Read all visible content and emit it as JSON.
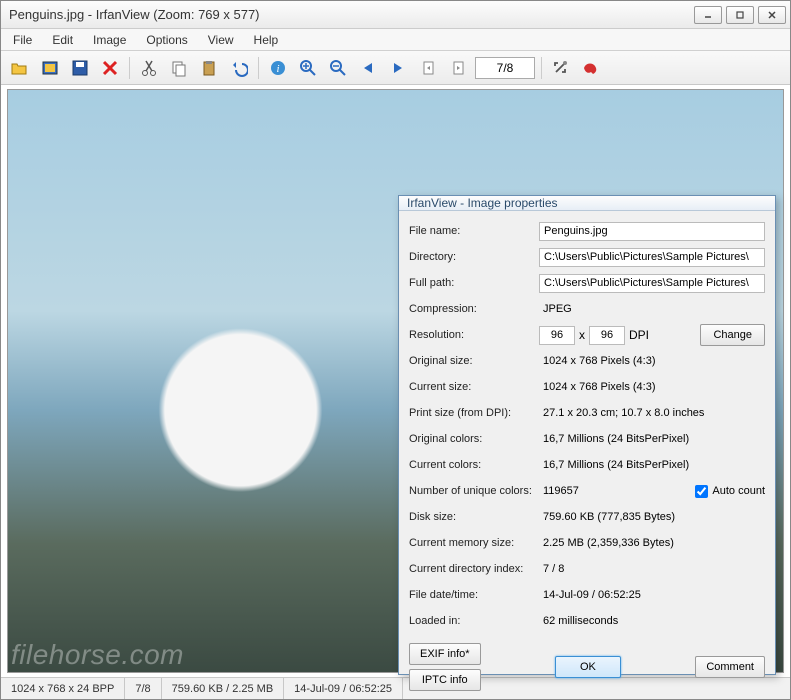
{
  "window": {
    "title": "Penguins.jpg - IrfanView (Zoom: 769 x 577)"
  },
  "menu": {
    "file": "File",
    "edit": "Edit",
    "image": "Image",
    "options": "Options",
    "view": "View",
    "help": "Help"
  },
  "toolbar": {
    "nav_index": "7/8"
  },
  "status": {
    "dim": "1024 x 768 x 24 BPP",
    "index": "7/8",
    "size": "759.60 KB / 2.25 MB",
    "date": "14-Jul-09 / 06:52:25"
  },
  "watermark": "filehorse.com",
  "dialog": {
    "title": "IrfanView - Image properties",
    "labels": {
      "filename": "File name:",
      "directory": "Directory:",
      "fullpath": "Full path:",
      "compression": "Compression:",
      "resolution": "Resolution:",
      "original_size": "Original size:",
      "current_size": "Current size:",
      "print_size": "Print size (from DPI):",
      "original_colors": "Original colors:",
      "current_colors": "Current colors:",
      "unique_colors": "Number of unique colors:",
      "disk_size": "Disk size:",
      "memory_size": "Current memory size:",
      "dir_index": "Current directory index:",
      "file_date": "File date/time:",
      "loaded_in": "Loaded in:"
    },
    "values": {
      "filename": "Penguins.jpg",
      "directory": "C:\\Users\\Public\\Pictures\\Sample Pictures\\",
      "fullpath": "C:\\Users\\Public\\Pictures\\Sample Pictures\\",
      "compression": "JPEG",
      "res_x": "96",
      "res_x_sep": "x",
      "res_y": "96",
      "res_dpi": "DPI",
      "change": "Change",
      "original_size": "1024 x 768  Pixels (4:3)",
      "current_size": "1024 x 768  Pixels (4:3)",
      "print_size": "27.1 x 20.3 cm; 10.7 x 8.0 inches",
      "original_colors": "16,7 Millions   (24 BitsPerPixel)",
      "current_colors": "16,7 Millions   (24 BitsPerPixel)",
      "unique_colors": "119657",
      "auto_count": "Auto count",
      "disk_size": "759.60 KB (777,835 Bytes)",
      "memory_size": "2.25  MB (2,359,336 Bytes)",
      "dir_index": "7  /  8",
      "file_date": "14-Jul-09 / 06:52:25",
      "loaded_in": "62 milliseconds"
    },
    "buttons": {
      "exif": "EXIF info*",
      "iptc": "IPTC info",
      "ok": "OK",
      "comment": "Comment"
    }
  }
}
